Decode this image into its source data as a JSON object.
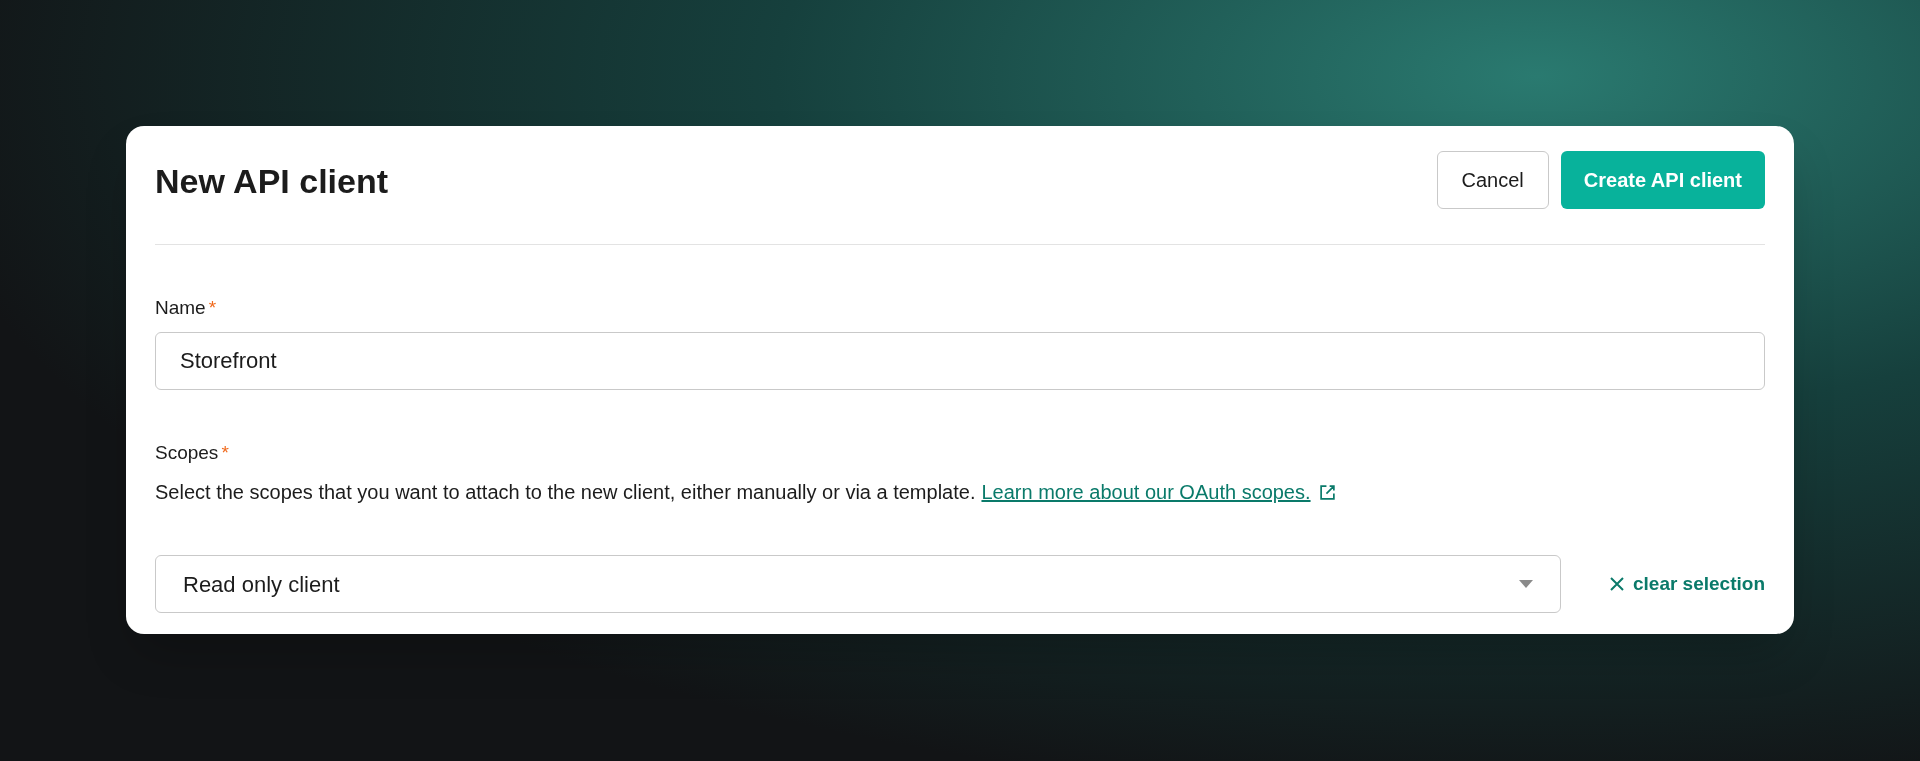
{
  "dialog": {
    "title": "New API client",
    "buttons": [
      {
        "kind": "secondary",
        "label": "Cancel"
      },
      {
        "kind": "primary",
        "label": "Create API client"
      }
    ]
  },
  "fields": [
    {
      "label": "Name",
      "required_mark": "*",
      "value": "Storefront"
    }
  ],
  "scopes": {
    "label": "Scopes",
    "required_mark": "*",
    "description": "Select the scopes that you want to attach to the new client, either manually or via a template.",
    "link": "Learn more about our OAuth scopes.",
    "select_value": "Read only client",
    "clear_label": "clear selection"
  }
}
